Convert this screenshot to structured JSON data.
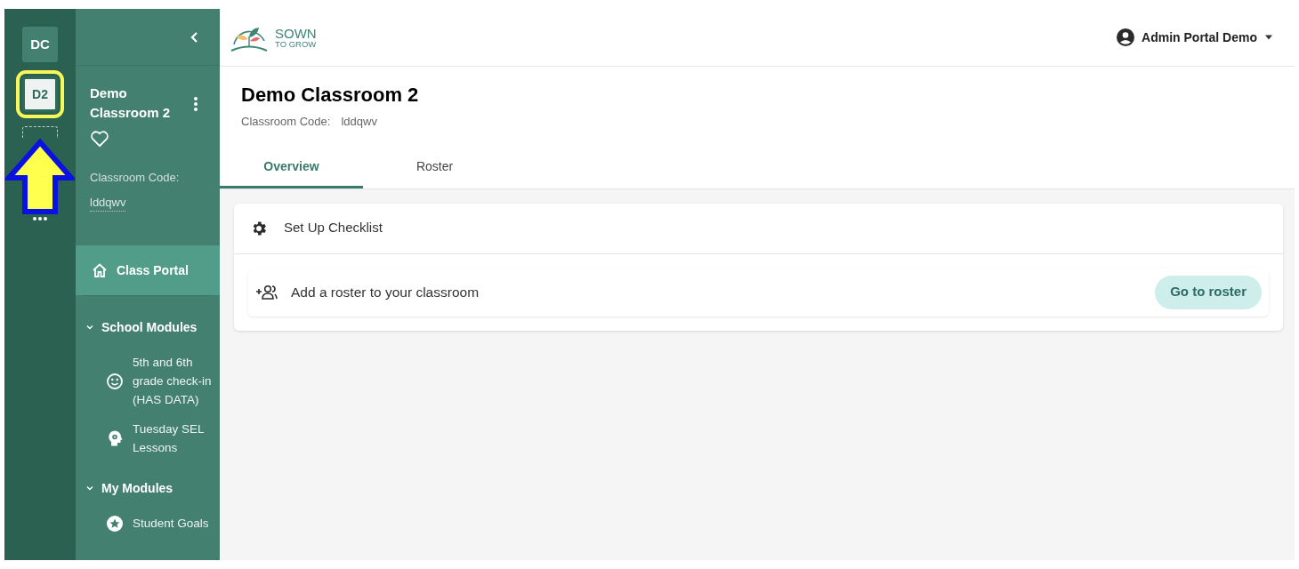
{
  "rail": {
    "items": [
      {
        "label": "DC",
        "selected": false
      },
      {
        "label": "D2",
        "selected": true
      }
    ]
  },
  "panel": {
    "classroom_name": "Demo Classroom 2",
    "favorited": false,
    "code_label": "Classroom Code:",
    "code": "lddqwv",
    "nav": [
      {
        "label": "Class Portal",
        "selected": true
      }
    ],
    "sections": [
      {
        "title": "School Modules",
        "expanded": true,
        "items": [
          {
            "label": "5th and 6th grade check-in (HAS DATA)",
            "kind": "smiley"
          },
          {
            "label": "Tuesday SEL Lessons",
            "kind": "head"
          }
        ]
      },
      {
        "title": "My Modules",
        "expanded": true,
        "items": [
          {
            "label": "Student Goals",
            "kind": "star"
          }
        ]
      }
    ]
  },
  "header": {
    "logo": {
      "line_1": "SOWN",
      "line_2": "TO GROW"
    },
    "user": "Admin Portal Demo"
  },
  "page": {
    "title": "Demo Classroom 2",
    "code_label": "Classroom Code:",
    "code": "lddqwv",
    "tabs": [
      {
        "label": "Overview",
        "selected": true
      },
      {
        "label": "Roster",
        "selected": false
      }
    ],
    "checklist": {
      "title": "Set Up Checklist",
      "tasks": [
        {
          "label": "Add a roster to your classroom",
          "action": "Go to roster"
        }
      ]
    }
  }
}
